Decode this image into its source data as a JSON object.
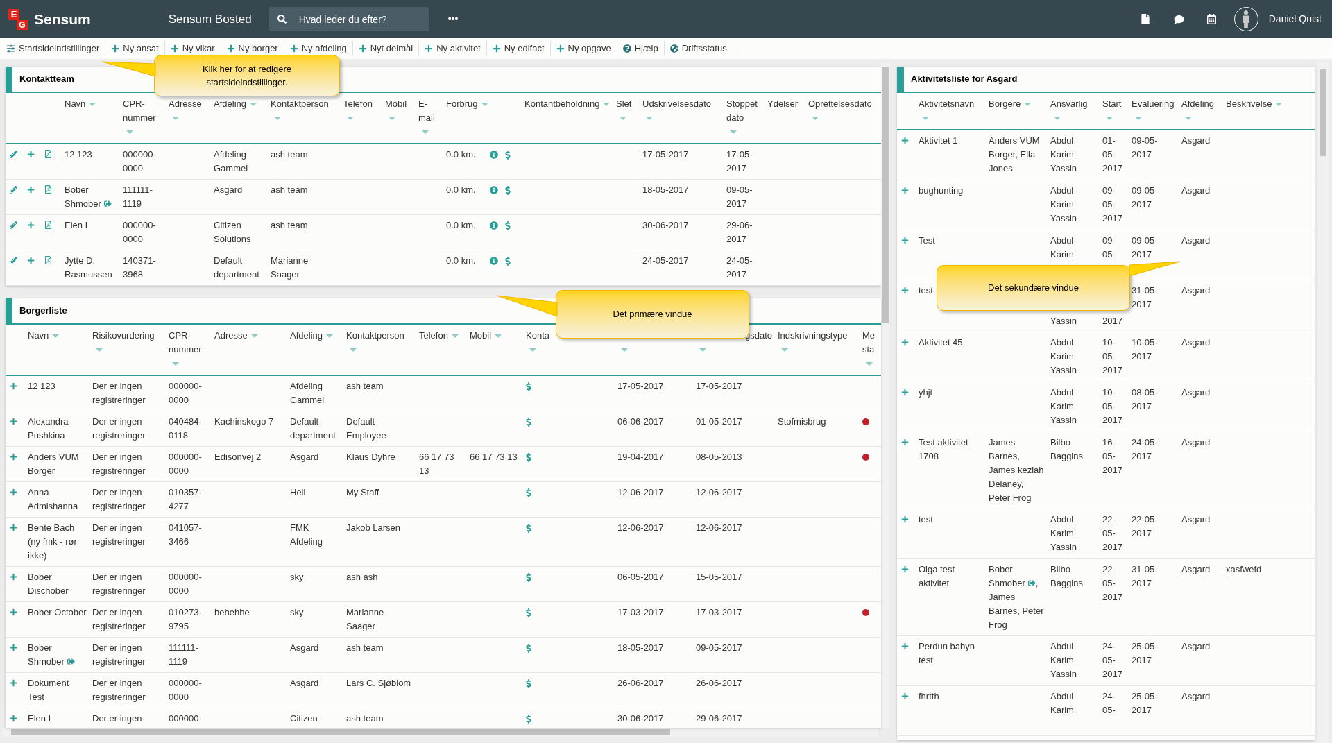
{
  "top_bar": {
    "logo": {
      "mark": [
        "E",
        "G"
      ],
      "name": "Sensum"
    },
    "title": "Sensum Bosted",
    "search": {
      "placeholder": "Hvad leder du efter?"
    },
    "more": "•••",
    "user": "Daniel Quist"
  },
  "toolbar": [
    {
      "kind": "settings",
      "label": "Startsideindstillinger"
    },
    {
      "kind": "add",
      "label": "Ny ansat"
    },
    {
      "kind": "add",
      "label": "Ny vikar"
    },
    {
      "kind": "add",
      "label": "Ny borger"
    },
    {
      "kind": "add",
      "label": "Ny afdeling"
    },
    {
      "kind": "add",
      "label": "Nyt delmål"
    },
    {
      "kind": "add",
      "label": "Ny aktivitet"
    },
    {
      "kind": "add",
      "label": "Ny edifact"
    },
    {
      "kind": "add",
      "label": "Ny opgave"
    },
    {
      "kind": "help",
      "label": "Hjælp"
    },
    {
      "kind": "status",
      "label": "Driftsstatus"
    }
  ],
  "callouts": [
    {
      "text": "Klik her for at redigere startsideindstillinger."
    },
    {
      "text": "Det primære vindue"
    },
    {
      "text": "Det sekundære vindue"
    }
  ],
  "kontaktteam": {
    "title": "Kontaktteam",
    "columns": [
      {
        "label": "Navn",
        "sortable": true
      },
      {
        "label": "CPR-nummer",
        "sortable": true
      },
      {
        "label": "Adresse",
        "sortable": true
      },
      {
        "label": "Afdeling",
        "sortable": true
      },
      {
        "label": "Kontaktperson",
        "sortable": true
      },
      {
        "label": "Telefon",
        "sortable": true
      },
      {
        "label": "Mobil",
        "sortable": true
      },
      {
        "label": "E-mail",
        "sortable": true
      },
      {
        "label": "Forbrug",
        "sortable": true
      },
      {
        "label": "Kontantbeholdning",
        "sortable": true
      },
      {
        "label": "Slet",
        "sortable": true
      },
      {
        "label": "Udskrivelsesdato",
        "sortable": true
      },
      {
        "label": "Stoppet dato",
        "sortable": true
      },
      {
        "label": "Ydelser",
        "sortable": false
      },
      {
        "label": "Oprettelsesdato",
        "sortable": true
      }
    ],
    "rows": [
      {
        "navn": "12 123",
        "exit": false,
        "cpr": "000000-0000",
        "afdeling": "Afdeling Gammel",
        "kontaktperson": "ash team",
        "forbrug": "0.0 km.",
        "udskrivelsesdato": "17-05-2017",
        "stoppet_dato": "17-05-2017"
      },
      {
        "navn": "Bober Shmober",
        "exit": true,
        "cpr": "111111-1119",
        "afdeling": "Asgard",
        "kontaktperson": "ash team",
        "forbrug": "0.0 km.",
        "udskrivelsesdato": "18-05-2017",
        "stoppet_dato": "09-05-2017"
      },
      {
        "navn": "Elen L",
        "exit": false,
        "cpr": "000000-0000",
        "afdeling": "Citizen Solutions",
        "kontaktperson": "ash team",
        "forbrug": "0.0 km.",
        "udskrivelsesdato": "30-06-2017",
        "stoppet_dato": "29-06-2017"
      },
      {
        "navn": "Jytte D. Rasmussen",
        "exit": false,
        "cpr": "140371-3968",
        "afdeling": "Default department",
        "kontaktperson": "Marianne Saager",
        "forbrug": "0.0 km.",
        "udskrivelsesdato": "24-05-2017",
        "stoppet_dato": "24-05-2017"
      }
    ]
  },
  "borgerliste": {
    "title": "Borgerliste",
    "columns": [
      {
        "label": "Navn",
        "sortable": true
      },
      {
        "label": "Risikovurdering",
        "sortable": true
      },
      {
        "label": "CPR-nummer",
        "sortable": true
      },
      {
        "label": "Adresse",
        "sortable": true
      },
      {
        "label": "Afdeling",
        "sortable": true
      },
      {
        "label": "Kontaktperson",
        "sortable": true
      },
      {
        "label": "Telefon",
        "sortable": true
      },
      {
        "label": "Mobil",
        "sortable": true
      },
      {
        "label": "Konta",
        "sortable": true,
        "clipped_start": false,
        "clipped_end": true
      },
      {
        "sortable": true,
        "clipped_end": true
      },
      {
        "label": "gsdato",
        "sortable": true,
        "clipped_start": true,
        "clipped_end": true
      },
      {
        "label": "Indskrivningstype",
        "sortable": true
      },
      {
        "label": "Me sta",
        "sortable": true
      }
    ],
    "rows": [
      {
        "navn": "12 123",
        "exit": false,
        "risikovurdering": "Der er ingen registreringer",
        "cpr": "000000-0000",
        "afdeling": "Afdeling Gammel",
        "kontaktperson": "ash team",
        "column_10": "17-05-2017",
        "column_11": "17-05-2017",
        "alert": false
      },
      {
        "navn": "Alexandra Pushkina",
        "exit": false,
        "risikovurdering": "Der er ingen registreringer",
        "cpr": "040484-0118",
        "adresse": "Kachinskogo 7",
        "afdeling": "Default department",
        "kontaktperson": "Default Employee",
        "column_10": "06-06-2017",
        "column_11": "01-05-2017",
        "indskrivningstype": "Stofmisbrug",
        "alert": true
      },
      {
        "navn": "Anders VUM Borger",
        "exit": false,
        "risikovurdering": "Der er ingen registreringer",
        "cpr": "000000-0000",
        "adresse": "Edisonvej 2",
        "afdeling": "Asgard",
        "kontaktperson": "Klaus Dyhre",
        "telefon": "66 17 73 13",
        "mobil": "66 17 73 13",
        "column_10": "19-04-2017",
        "column_11": "08-05-2013",
        "alert": true
      },
      {
        "navn": "Anna Admishanna",
        "exit": false,
        "risikovurdering": "Der er ingen registreringer",
        "cpr": "010357-4277",
        "afdeling": "Hell",
        "kontaktperson": "My Staff",
        "column_10": "12-06-2017",
        "column_11": "12-06-2017",
        "alert": false
      },
      {
        "navn": "Bente Bach (ny fmk - rør ikke)",
        "exit": false,
        "risikovurdering": "Der er ingen registreringer",
        "cpr": "041057-3466",
        "afdeling": "FMK Afdeling",
        "kontaktperson": "Jakob Larsen",
        "column_10": "12-06-2017",
        "column_11": "12-06-2017",
        "alert": false
      },
      {
        "navn": "Bober Dischober",
        "exit": false,
        "risikovurdering": "Der er ingen registreringer",
        "cpr": "000000-0000",
        "afdeling": "sky",
        "kontaktperson": "ash ash",
        "column_10": "06-05-2017",
        "column_11": "15-05-2017",
        "alert": false
      },
      {
        "navn": "Bober October",
        "exit": false,
        "risikovurdering": "Der er ingen registreringer",
        "cpr": "010273-9795",
        "adresse": "hehehhe",
        "afdeling": "sky",
        "kontaktperson": "Marianne Saager",
        "column_10": "17-03-2017",
        "column_11": "17-03-2017",
        "alert": true
      },
      {
        "navn": "Bober Shmober",
        "exit": true,
        "risikovurdering": "Der er ingen registreringer",
        "cpr": "111111-1119",
        "afdeling": "Asgard",
        "kontaktperson": "ash team",
        "column_10": "18-05-2017",
        "column_11": "09-05-2017",
        "alert": false
      },
      {
        "navn": "Dokument Test",
        "exit": false,
        "risikovurdering": "Der er ingen registreringer",
        "cpr": "000000-0000",
        "afdeling": "Asgard",
        "kontaktperson": "Lars C. Sjøblom",
        "column_10": "26-06-2017",
        "column_11": "26-06-2017",
        "alert": false
      },
      {
        "navn": "Elen L",
        "exit": false,
        "risikovurdering": "Der er ingen",
        "cpr": "000000-",
        "afdeling": "Citizen",
        "kontaktperson": "ash team",
        "column_10": "30-06-2017",
        "column_11": "29-06-2017",
        "alert": false
      }
    ]
  },
  "aktivitetsliste": {
    "title": "Aktivitetsliste for Asgard",
    "columns": [
      {
        "label": "Aktivitetsnavn",
        "sortable": true
      },
      {
        "label": "Borgere",
        "sortable": true
      },
      {
        "label": "Ansvarlig",
        "sortable": true
      },
      {
        "label": "Start",
        "sortable": true
      },
      {
        "label": "Evaluering",
        "sortable": true
      },
      {
        "label": "Afdeling",
        "sortable": true
      },
      {
        "label": "Beskrivelse",
        "sortable": true
      }
    ],
    "rows": [
      {
        "aktivitetsnavn": "Aktivitet 1",
        "borgere": [
          {
            "text": "Anders VUM Borger, Ella Jones",
            "exit": false
          }
        ],
        "ansvarlig": "Abdul Karim Yassin",
        "start": "01-05-2017",
        "evaluering": "09-05-2017",
        "afdeling": "Asgard",
        "obscured": false
      },
      {
        "aktivitetsnavn": "bughunting",
        "ansvarlig": "Abdul Karim Yassin",
        "start": "09-05-2017",
        "evaluering": "09-05-2017",
        "afdeling": "Asgard",
        "obscured": false
      },
      {
        "aktivitetsnavn": "Test",
        "ansvarlig": "Abdul Karim",
        "start": "09-05-",
        "evaluering": "09-05-2017",
        "afdeling": "Asgard",
        "obscured": false
      },
      {
        "aktivitetsnavn": "test",
        "ansvarlig": "Yassin",
        "start": "2017",
        "evaluering": "31-05-2017",
        "afdeling": "Asgard",
        "obscured": true
      },
      {
        "aktivitetsnavn": "Aktivitet 45",
        "ansvarlig": "Abdul Karim Yassin",
        "start": "10-05-2017",
        "evaluering": "10-05-2017",
        "afdeling": "Asgard",
        "obscured": false
      },
      {
        "aktivitetsnavn": "yhjt",
        "ansvarlig": "Abdul Karim Yassin",
        "start": "10-05-2017",
        "evaluering": "08-05-2017",
        "afdeling": "Asgard",
        "obscured": false
      },
      {
        "aktivitetsnavn": "Test aktivitet 1708",
        "borgere": [
          {
            "text": "James Barnes, James keziah Delaney, Peter Frog",
            "exit": false
          }
        ],
        "ansvarlig": "Bilbo Baggins",
        "start": "16-05-2017",
        "evaluering": "24-05-2017",
        "afdeling": "Asgard",
        "obscured": false
      },
      {
        "aktivitetsnavn": "test",
        "ansvarlig": "Abdul Karim Yassin",
        "start": "22-05-2017",
        "evaluering": "22-05-2017",
        "afdeling": "Asgard",
        "obscured": false
      },
      {
        "aktivitetsnavn": "Olga test aktivitet",
        "borgere": [
          {
            "text": "Bober Shmober",
            "exit": true,
            "suffix": ","
          },
          {
            "text": "James Barnes, Peter Frog",
            "exit": false
          }
        ],
        "ansvarlig": "Bilbo Baggins",
        "start": "22-05-2017",
        "evaluering": "31-05-2017",
        "afdeling": "Asgard",
        "beskrivelse": "xasfwefd",
        "obscured": false
      },
      {
        "aktivitetsnavn": "Perdun babyn test",
        "ansvarlig": "Abdul Karim Yassin",
        "start": "24-05-2017",
        "evaluering": "25-05-2017",
        "afdeling": "Asgard",
        "obscured": false
      },
      {
        "aktivitetsnavn": "fhrtth",
        "ansvarlig": "Abdul Karim",
        "start": "24-05-",
        "evaluering": "25-05-2017",
        "afdeling": "Asgard",
        "obscured": false
      }
    ]
  }
}
